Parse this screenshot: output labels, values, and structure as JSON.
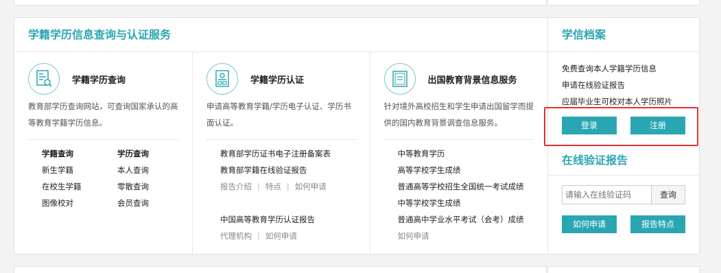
{
  "main": {
    "title": "学籍学历信息查询与认证服务",
    "columns": [
      {
        "title": "学籍学历查询",
        "icon": "document-search-icon",
        "desc": "教育部学历查询网站，可查询国家承认的高等教育学籍学历信息。",
        "grid": [
          [
            "学籍查询",
            "学历查询"
          ],
          [
            "新生学籍",
            "本人查询"
          ],
          [
            "在校生学籍",
            "零散查询"
          ],
          [
            "图像校对",
            "会员查询"
          ]
        ]
      },
      {
        "title": "学籍学历认证",
        "icon": "certificate-icon",
        "desc": "申请高等教育学籍/学历电子认证、学历书面认证。",
        "links1": [
          "教育部学历证书电子注册备案表",
          "教育部学籍在线验证报告"
        ],
        "sub1": [
          "报告介绍",
          "特点",
          "如何申请"
        ],
        "links2": [
          "中国高等教育学历认证报告"
        ],
        "sub2": [
          "代理机构",
          "如何申请"
        ]
      },
      {
        "title": "出国教育背景信息服务",
        "icon": "diploma-icon",
        "desc": "针对境外高校招生和学生申请出国留学而提供的国内教育背景调查信息服务。",
        "links": [
          "中等教育学历",
          "高等学校学生成绩",
          "普通高等学校招生全国统一考试成绩",
          "中等学校学生成绩",
          "普通高中学业水平考试（会考）成绩"
        ],
        "footer": "如何申请"
      }
    ]
  },
  "side": {
    "title": "学信档案",
    "items": [
      "免费查询本人学籍学历信息",
      "申请在线验证报告",
      "应届毕业生可校对本人学历照片"
    ],
    "login": "登录",
    "register": "注册",
    "title2": "在线验证报告",
    "input_placeholder": "请输入在线验证码",
    "search": "查询",
    "how_apply": "如何申请",
    "features": "报告特点"
  },
  "colors": {
    "accent": "#2aa6b3",
    "highlight": "#e53030"
  }
}
